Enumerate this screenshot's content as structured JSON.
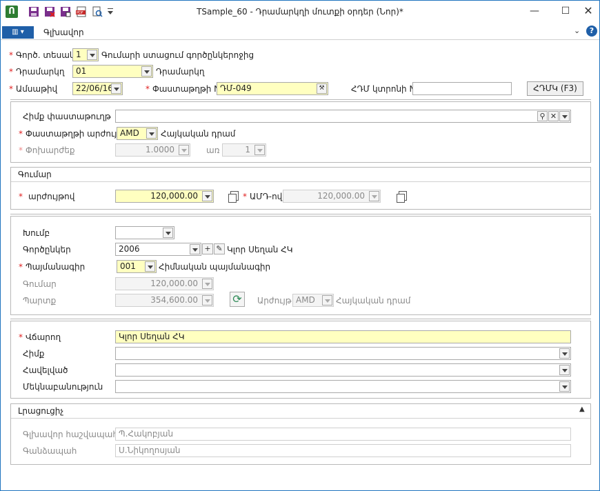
{
  "window": {
    "title": "TSample_60 - Դրամարկղի մուտքի օրդեր (Նոր)*"
  },
  "menubar": {
    "main_tab": "Գլխավոր"
  },
  "header": {
    "op_type": {
      "label": "Գործ. տեսակ",
      "value": "1",
      "desc": "Գումարի ստացում գործընկերոջից"
    },
    "cashbox": {
      "label": "Դրամարկղ",
      "value": "01",
      "desc": "Դրամարկղ"
    },
    "date": {
      "label": "Ամսաթիվ",
      "value": "22/06/16"
    },
    "doc_number": {
      "label": "Փաստաթղթի N",
      "value": "ԴՄ-049"
    },
    "hdm_check": {
      "label": "ՀԴՄ կտրոնի N",
      "value": ""
    },
    "hdm_button": "ՀԴՄԿ (F3)"
  },
  "doc": {
    "basis_doc": {
      "label": "Հիմք փաստաթուղթ",
      "value": ""
    },
    "currency": {
      "label": "Փաստաթղթի արժույթ",
      "value": "AMD",
      "desc": "Հայկական դրամ"
    },
    "rate": {
      "label": "Փոխարժեք",
      "value": "1.0000",
      "per_label": "առ",
      "per_value": "1"
    }
  },
  "amount": {
    "section_title": "Գումար",
    "in_currency_label": "արժույթով",
    "in_currency_value": "120,000.00",
    "in_amd_label": "ԱՄԴ-ով",
    "in_amd_value": "120,000.00"
  },
  "partner": {
    "group": {
      "label": "Խումբ",
      "value": ""
    },
    "partners": {
      "label": "Գործընկեր",
      "value": "2006",
      "desc": "Կլոր Սեղան ՀԿ"
    },
    "contract": {
      "label": "Պայմանագիր",
      "value": "001",
      "desc": "Հիմնական պայմանագիր"
    },
    "sum": {
      "label": "Գումար",
      "value": "120,000.00"
    },
    "debt": {
      "label": "Պարտք",
      "value": "354,600.00",
      "currency_label": "Արժույթ",
      "currency_value": "AMD",
      "currency_desc": "Հայկական դրամ"
    }
  },
  "payer": {
    "payer": {
      "label": "Վճարող",
      "value": "Կլոր Սեղան ՀԿ"
    },
    "basis": {
      "label": "Հիմք",
      "value": ""
    },
    "attached": {
      "label": "Հավելված",
      "value": ""
    },
    "comment": {
      "label": "Մեկնաբանություն",
      "value": ""
    }
  },
  "extra": {
    "section_title": "Լրացուցիչ",
    "chief_accountant": {
      "label": "Գլխավոր հաշվապահ",
      "value": "Պ.Հակոբյան"
    },
    "cashier": {
      "label": "Գանձապահ",
      "value": "Ս.Նիկողոսյան"
    }
  },
  "colors": {
    "accent": "#1f5fa8",
    "required": "#e02020",
    "highlight": "#ffffc0"
  }
}
